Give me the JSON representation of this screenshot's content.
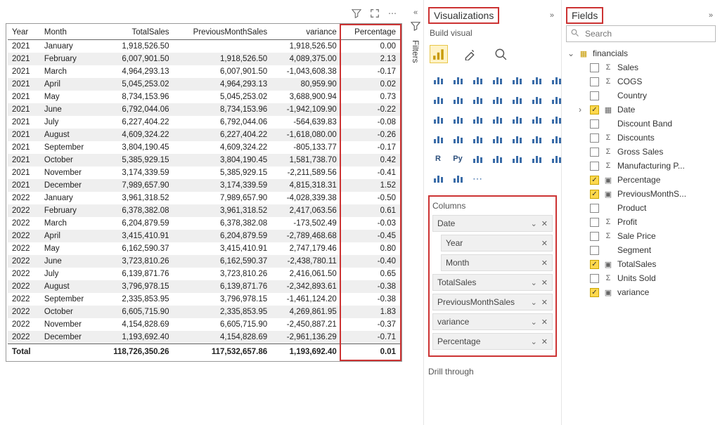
{
  "panes": {
    "visualizations": "Visualizations",
    "fields": "Fields",
    "filters": "Filters",
    "build_visual": "Build visual",
    "columns": "Columns",
    "drill_through": "Drill through"
  },
  "search": {
    "placeholder": "Search"
  },
  "column_wells": [
    {
      "label": "Date",
      "has_chevron": true
    },
    {
      "label": "Year",
      "indent": true
    },
    {
      "label": "Month",
      "indent": true
    },
    {
      "label": "TotalSales",
      "has_chevron": true
    },
    {
      "label": "PreviousMonthSales",
      "has_chevron": true
    },
    {
      "label": "variance",
      "has_chevron": true
    },
    {
      "label": "Percentage",
      "has_chevron": true
    }
  ],
  "fields_tree": {
    "table": "financials",
    "items": [
      {
        "label": "Sales",
        "checked": false,
        "icon": "Σ"
      },
      {
        "label": "COGS",
        "checked": false,
        "icon": "Σ"
      },
      {
        "label": "Country",
        "checked": false,
        "icon": ""
      },
      {
        "label": "Date",
        "checked": true,
        "icon": "▦",
        "expandable": true
      },
      {
        "label": "Discount Band",
        "checked": false,
        "icon": ""
      },
      {
        "label": "Discounts",
        "checked": false,
        "icon": "Σ"
      },
      {
        "label": "Gross Sales",
        "checked": false,
        "icon": "Σ"
      },
      {
        "label": "Manufacturing P...",
        "checked": false,
        "icon": "Σ"
      },
      {
        "label": "Percentage",
        "checked": true,
        "icon": "▣"
      },
      {
        "label": "PreviousMonthS...",
        "checked": true,
        "icon": "▣"
      },
      {
        "label": "Product",
        "checked": false,
        "icon": ""
      },
      {
        "label": "Profit",
        "checked": false,
        "icon": "Σ"
      },
      {
        "label": "Sale Price",
        "checked": false,
        "icon": "Σ"
      },
      {
        "label": "Segment",
        "checked": false,
        "icon": ""
      },
      {
        "label": "TotalSales",
        "checked": true,
        "icon": "▣"
      },
      {
        "label": "Units Sold",
        "checked": false,
        "icon": "Σ"
      },
      {
        "label": "variance",
        "checked": true,
        "icon": "▣"
      }
    ]
  },
  "table": {
    "headers": [
      "Year",
      "Month",
      "TotalSales",
      "PreviousMonthSales",
      "variance",
      "Percentage"
    ],
    "rows": [
      [
        "2021",
        "January",
        "1,918,526.50",
        "",
        "1,918,526.50",
        "0.00"
      ],
      [
        "2021",
        "February",
        "6,007,901.50",
        "1,918,526.50",
        "4,089,375.00",
        "2.13"
      ],
      [
        "2021",
        "March",
        "4,964,293.13",
        "6,007,901.50",
        "-1,043,608.38",
        "-0.17"
      ],
      [
        "2021",
        "April",
        "5,045,253.02",
        "4,964,293.13",
        "80,959.90",
        "0.02"
      ],
      [
        "2021",
        "May",
        "8,734,153.96",
        "5,045,253.02",
        "3,688,900.94",
        "0.73"
      ],
      [
        "2021",
        "June",
        "6,792,044.06",
        "8,734,153.96",
        "-1,942,109.90",
        "-0.22"
      ],
      [
        "2021",
        "July",
        "6,227,404.22",
        "6,792,044.06",
        "-564,639.83",
        "-0.08"
      ],
      [
        "2021",
        "August",
        "4,609,324.22",
        "6,227,404.22",
        "-1,618,080.00",
        "-0.26"
      ],
      [
        "2021",
        "September",
        "3,804,190.45",
        "4,609,324.22",
        "-805,133.77",
        "-0.17"
      ],
      [
        "2021",
        "October",
        "5,385,929.15",
        "3,804,190.45",
        "1,581,738.70",
        "0.42"
      ],
      [
        "2021",
        "November",
        "3,174,339.59",
        "5,385,929.15",
        "-2,211,589.56",
        "-0.41"
      ],
      [
        "2021",
        "December",
        "7,989,657.90",
        "3,174,339.59",
        "4,815,318.31",
        "1.52"
      ],
      [
        "2022",
        "January",
        "3,961,318.52",
        "7,989,657.90",
        "-4,028,339.38",
        "-0.50"
      ],
      [
        "2022",
        "February",
        "6,378,382.08",
        "3,961,318.52",
        "2,417,063.56",
        "0.61"
      ],
      [
        "2022",
        "March",
        "6,204,879.59",
        "6,378,382.08",
        "-173,502.49",
        "-0.03"
      ],
      [
        "2022",
        "April",
        "3,415,410.91",
        "6,204,879.59",
        "-2,789,468.68",
        "-0.45"
      ],
      [
        "2022",
        "May",
        "6,162,590.37",
        "3,415,410.91",
        "2,747,179.46",
        "0.80"
      ],
      [
        "2022",
        "June",
        "3,723,810.26",
        "6,162,590.37",
        "-2,438,780.11",
        "-0.40"
      ],
      [
        "2022",
        "July",
        "6,139,871.76",
        "3,723,810.26",
        "2,416,061.50",
        "0.65"
      ],
      [
        "2022",
        "August",
        "3,796,978.15",
        "6,139,871.76",
        "-2,342,893.61",
        "-0.38"
      ],
      [
        "2022",
        "September",
        "2,335,853.95",
        "3,796,978.15",
        "-1,461,124.20",
        "-0.38"
      ],
      [
        "2022",
        "October",
        "6,605,715.90",
        "2,335,853.95",
        "4,269,861.95",
        "1.83"
      ],
      [
        "2022",
        "November",
        "4,154,828.69",
        "6,605,715.90",
        "-2,450,887.21",
        "-0.37"
      ],
      [
        "2022",
        "December",
        "1,193,692.40",
        "4,154,828.69",
        "-2,961,136.29",
        "-0.71"
      ]
    ],
    "total_label": "Total",
    "totals": [
      "118,726,350.26",
      "117,532,657.86",
      "1,193,692.40",
      "0.01"
    ]
  },
  "viz_icons": [
    "stacked-bar",
    "stacked-col",
    "clustered-bar",
    "clustered-col",
    "100-bar",
    "100-col",
    "line",
    "area",
    "stacked-area",
    "line-col",
    "line-col2",
    "ribbon",
    "waterfall",
    "funnel",
    "scatter",
    "pie",
    "donut",
    "treemap",
    "map",
    "filled-map",
    "azure-map",
    "gauge",
    "card",
    "multi-card",
    "kpi",
    "slicer",
    "table",
    "matrix",
    "r",
    "python",
    "key-influencer",
    "decomp",
    "qna",
    "narrative",
    "paginated",
    "arcgis",
    "powerapps",
    "more"
  ]
}
